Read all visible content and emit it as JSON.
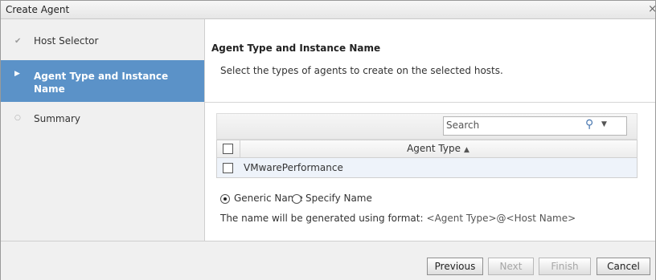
{
  "window": {
    "title": "Create Agent",
    "close_glyph": "×"
  },
  "sidebar": {
    "items": [
      {
        "label": "Host Selector",
        "icon": "check-icon",
        "glyph": "✔",
        "state": "done"
      },
      {
        "label": "Agent Type and Instance Name",
        "icon": "arrow-right-icon",
        "glyph": "▶",
        "state": "active"
      },
      {
        "label": "Summary",
        "icon": "circle-icon",
        "glyph": "○",
        "state": "pending"
      }
    ],
    "active_color": "#5b92c8"
  },
  "main": {
    "title": "Agent Type and Instance Name",
    "description": "Select the types of agents to create on the selected hosts.",
    "search": {
      "placeholder": "Search",
      "value": "",
      "icon": "search-icon",
      "glyph": "⚲",
      "dropdown_glyph": "▼"
    },
    "table": {
      "column_header": "Agent Type",
      "sort_glyph": "▲",
      "rows": [
        {
          "label": "VMwarePerformance",
          "checked": false
        }
      ]
    },
    "naming": {
      "options": [
        {
          "label": "Generic Name",
          "selected": true
        },
        {
          "label": "Specify Name",
          "selected": false
        }
      ],
      "format_label": "The name will be generated using format:",
      "format_value": "<Agent Type>@<Host Name>"
    }
  },
  "footer": {
    "buttons": [
      {
        "label": "Previous",
        "enabled": true
      },
      {
        "label": "Next",
        "enabled": false
      },
      {
        "label": "Finish",
        "enabled": false
      },
      {
        "label": "Cancel",
        "enabled": true
      }
    ]
  }
}
